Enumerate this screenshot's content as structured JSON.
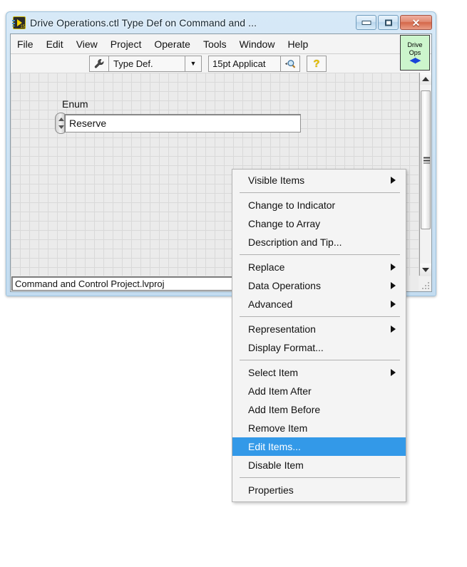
{
  "window": {
    "title": "Drive Operations.ctl Type Def on Command and ...",
    "icon": "labview-ctl-icon",
    "icon_badge": "15",
    "buttons": {
      "minimize": "minimize-icon",
      "maximize": "maximize-icon",
      "close": "✕"
    }
  },
  "menubar": {
    "items": [
      {
        "label": "File"
      },
      {
        "label": "Edit"
      },
      {
        "label": "View"
      },
      {
        "label": "Project"
      },
      {
        "label": "Operate"
      },
      {
        "label": "Tools"
      },
      {
        "label": "Window"
      },
      {
        "label": "Help"
      }
    ],
    "badge": {
      "line1": "Drive",
      "line2": "Ops",
      "icon": "left-right-arrow-icon"
    }
  },
  "toolbar": {
    "wrench_icon": "wrench-icon",
    "typedef_value": "Type Def.",
    "typedef_arrow": "▼",
    "font_value": "15pt Applicat",
    "zoom_icon": "magnifier-icon",
    "help_icon": "question-mark-icon"
  },
  "panel": {
    "enum_label": "Enum",
    "enum_value": "Reserve",
    "spinner_up": "increment-arrow-icon",
    "spinner_down": "decrement-arrow-icon"
  },
  "statusbar": {
    "path": "Command and Control Project.lvproj"
  },
  "scrollbar": {
    "up": "scroll-up-icon",
    "down": "scroll-down-icon",
    "grip": "scrollbar-grip-icon"
  },
  "context_menu": {
    "selected": "Edit Items...",
    "groups": [
      [
        {
          "label": "Visible Items",
          "submenu": true
        }
      ],
      [
        {
          "label": "Change to Indicator",
          "submenu": false
        },
        {
          "label": "Change to Array",
          "submenu": false
        },
        {
          "label": "Description and Tip...",
          "submenu": false
        }
      ],
      [
        {
          "label": "Replace",
          "submenu": true
        },
        {
          "label": "Data Operations",
          "submenu": true
        },
        {
          "label": "Advanced",
          "submenu": true
        }
      ],
      [
        {
          "label": "Representation",
          "submenu": true
        },
        {
          "label": "Display Format...",
          "submenu": false
        }
      ],
      [
        {
          "label": "Select Item",
          "submenu": true
        },
        {
          "label": "Add Item After",
          "submenu": false
        },
        {
          "label": "Add Item Before",
          "submenu": false
        },
        {
          "label": "Remove Item",
          "submenu": false
        },
        {
          "label": "Edit Items...",
          "submenu": false
        },
        {
          "label": "Disable Item",
          "submenu": false
        }
      ],
      [
        {
          "label": "Properties",
          "submenu": false
        }
      ]
    ]
  },
  "colors": {
    "menu_highlight": "#3399e8",
    "badge_green": "#ccf5cc",
    "frame_blue": "#cfe4f5"
  }
}
